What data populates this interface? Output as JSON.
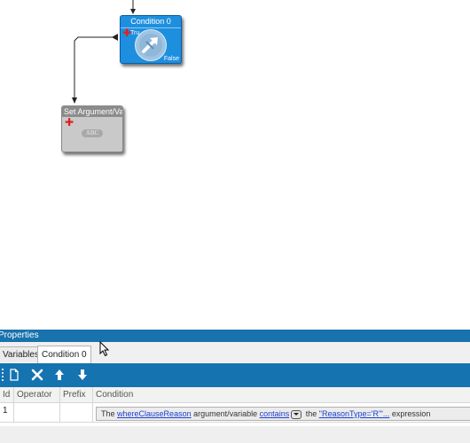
{
  "canvas": {
    "condition_node": {
      "title": "Condition 0",
      "true_label": "Tru",
      "false_label": "False",
      "color": "#1e8fdf"
    },
    "set_node": {
      "title": "Set Argument/Vari",
      "badge": "ABC",
      "color": "#c9c9c9"
    }
  },
  "properties": {
    "header": "Properties",
    "tabs": [
      {
        "label": "Variables"
      },
      {
        "label": "Condition 0",
        "active": true
      }
    ],
    "toolbar": {
      "icons": [
        "new-page-icon",
        "delete-x-icon",
        "move-up-arrow-icon",
        "move-down-arrow-icon"
      ]
    },
    "grid": {
      "columns": [
        "Id",
        "Operator",
        "Prefix",
        "Condition"
      ],
      "rows": [
        {
          "id": "1",
          "operator": "",
          "prefix": "",
          "condition": {
            "t1": "The",
            "link1": "whereClauseReason",
            "t2": "argument/variable",
            "link2": "contains",
            "t3": "the",
            "link3": "\"ReasonType='R'\"...",
            "t4": "expression"
          }
        }
      ]
    }
  },
  "colors": {
    "accent": "#1573b0",
    "header": "#1872ad",
    "link": "#1a3fd0",
    "plus": "#e02020"
  }
}
